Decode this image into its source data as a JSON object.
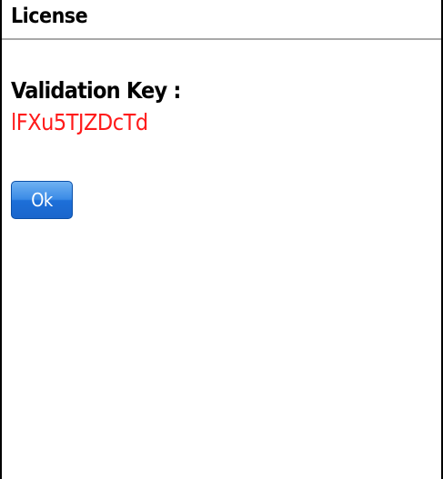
{
  "window": {
    "title": "License"
  },
  "license": {
    "label": "Validation Key :",
    "key": "lFXu5TJZDcTd"
  },
  "actions": {
    "ok_label": "Ok"
  },
  "colors": {
    "key_text": "#ff1a1a",
    "button_blue": "#1d6fd8",
    "divider": "#a9a9a9"
  }
}
